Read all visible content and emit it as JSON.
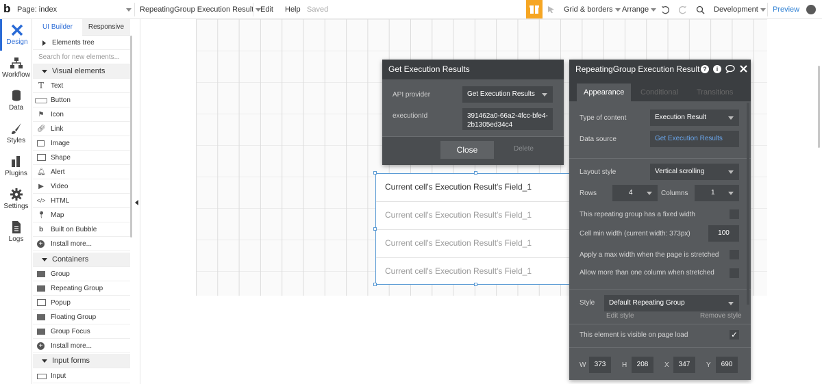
{
  "topbar": {
    "logo": "b",
    "page": "Page: index",
    "element": "RepeatingGroup Execution Result",
    "edit": "Edit",
    "help": "Help",
    "saved": "Saved",
    "grid": "Grid & borders",
    "arrange": "Arrange",
    "environment": "Development",
    "preview": "Preview"
  },
  "leftbar": {
    "items": [
      {
        "label": "Design",
        "icon": "design-icon"
      },
      {
        "label": "Workflow",
        "icon": "workflow-icon"
      },
      {
        "label": "Data",
        "icon": "data-icon"
      },
      {
        "label": "Styles",
        "icon": "styles-icon"
      },
      {
        "label": "Plugins",
        "icon": "plugins-icon"
      },
      {
        "label": "Settings",
        "icon": "settings-icon"
      },
      {
        "label": "Logs",
        "icon": "logs-icon"
      }
    ]
  },
  "panel": {
    "tabs": [
      "UI Builder",
      "Responsive"
    ],
    "elements_tree": "Elements tree",
    "search_placeholder": "Search for new elements...",
    "visual_elements": "Visual elements",
    "visual_items": [
      "Text",
      "Button",
      "Icon",
      "Link",
      "Image",
      "Shape",
      "Alert",
      "Video",
      "HTML",
      "Map",
      "Built on Bubble",
      "Install more..."
    ],
    "containers": "Containers",
    "container_items": [
      "Group",
      "Repeating Group",
      "Popup",
      "Floating Group",
      "Group Focus",
      "Install more..."
    ],
    "input_forms": "Input forms",
    "input_items": [
      "Input"
    ]
  },
  "canvas": {
    "rows": [
      "Current cell's Execution Result's Field_1",
      "Current cell's Execution Result's Field_1",
      "Current cell's Execution Result's Field_1",
      "Current cell's Execution Result's Field_1"
    ]
  },
  "popup": {
    "title": "Get Execution Results",
    "api_provider_label": "API provider",
    "api_provider_value": "Get Execution Results",
    "execution_id_label": "executionId",
    "execution_id_value_1": "391462a0-66a2-4fcc-bfe4-",
    "execution_id_value_2": "2b1305ed34c4",
    "close": "Close",
    "delete": "Delete"
  },
  "editor": {
    "title": "RepeatingGroup Execution Result",
    "tabs": [
      "Appearance",
      "Conditional",
      "Transitions"
    ],
    "type_label": "Type of content",
    "type_value": "Execution Result",
    "source_label": "Data source",
    "source_value": "Get Execution Results",
    "layout_label": "Layout style",
    "layout_value": "Vertical scrolling",
    "rows_label": "Rows",
    "rows_value": "4",
    "columns_label": "Columns",
    "columns_value": "1",
    "fixed_width": "This repeating group has a fixed width",
    "cell_min_label": "Cell min width (current width: 373px)",
    "cell_min_value": "100",
    "max_width": "Apply a max width when the page is stretched",
    "multi_column": "Allow more than one column when stretched",
    "style_label": "Style",
    "style_value": "Default Repeating Group",
    "edit_style": "Edit style",
    "remove_style": "Remove style",
    "visible_label": "This element is visible on page load",
    "w_label": "W",
    "w": "373",
    "h_label": "H",
    "h": "208",
    "x_label": "X",
    "x": "347",
    "y_label": "Y",
    "y": "690"
  }
}
